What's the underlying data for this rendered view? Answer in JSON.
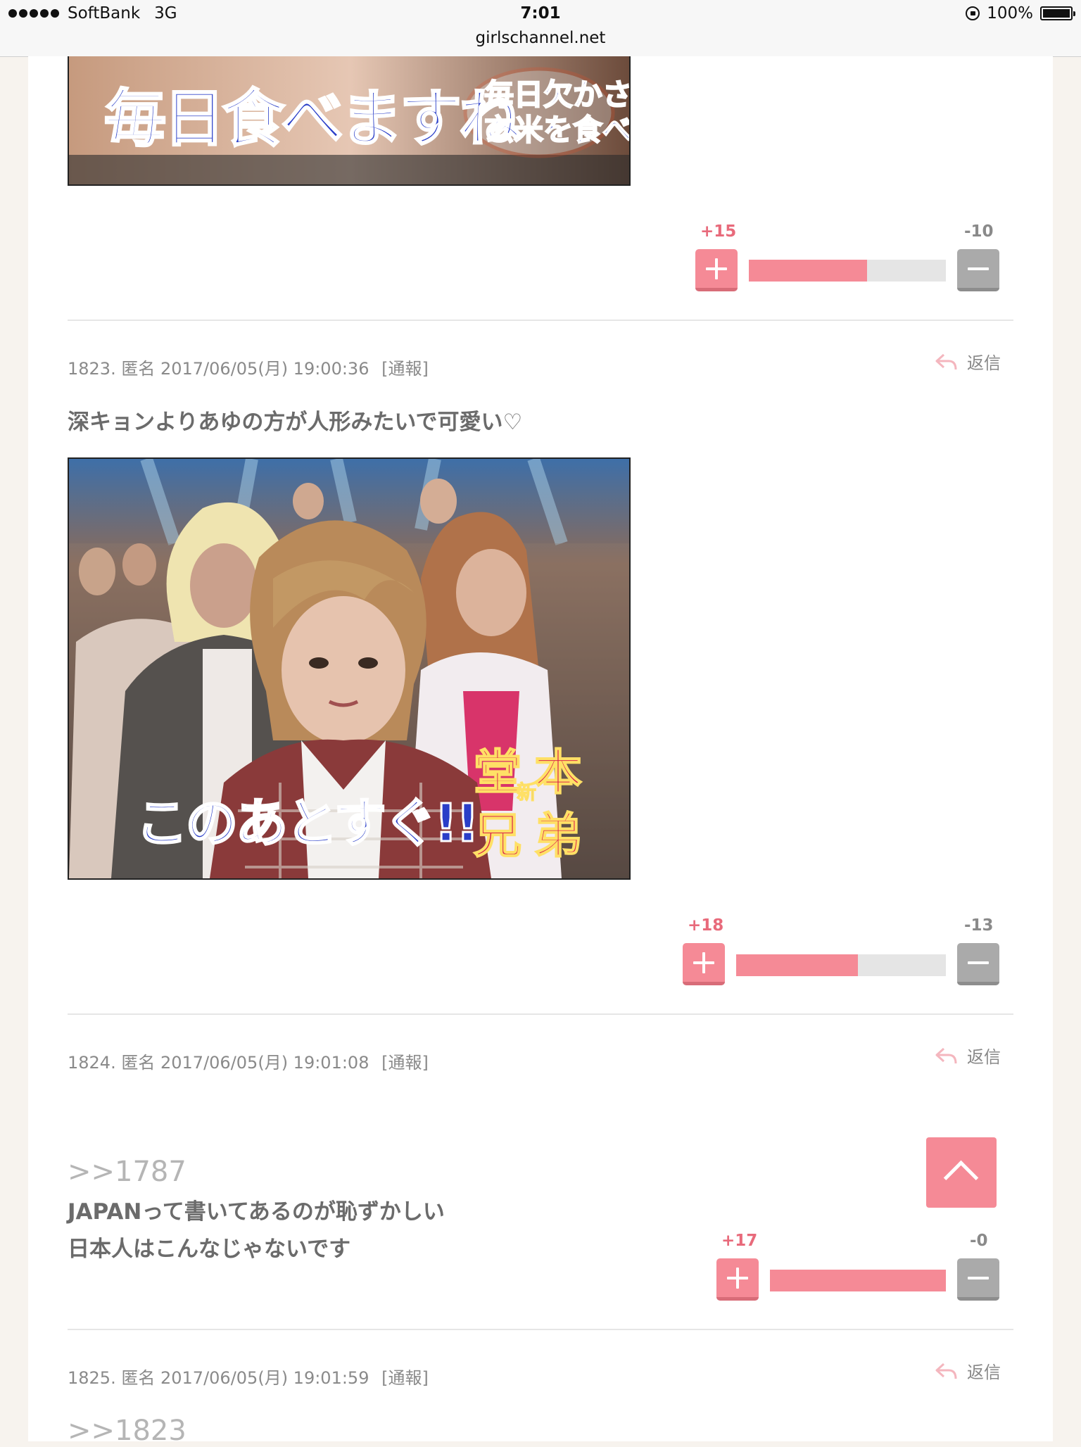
{
  "status_bar": {
    "carrier": "SoftBank",
    "network": "3G",
    "time": "7:01",
    "url": "girlschannel.net",
    "battery": "100%"
  },
  "colors": {
    "accent": "#f58a96",
    "panel": "#ffffff",
    "page_bg": "#f7f3ee"
  },
  "posts": [
    {
      "image_caption": "毎日食べますね",
      "image_subcaption_line1": "毎日欠かさず",
      "image_subcaption_line2": "玄米を食べる",
      "plus": "+15",
      "minus": "-10",
      "ratio": 0.6
    },
    {
      "number": "1823.",
      "author": "匿名",
      "datetime": "2017/06/05(月) 19:00:36",
      "report": "[通報]",
      "reply": "返信",
      "text": "深キョンよりあゆの方が人形みたいで可愛い♡",
      "image_caption": "このあとすぐ!!",
      "image_label_1": "堂本",
      "image_label_2": "兄弟",
      "image_label_small": "新",
      "plus": "+18",
      "minus": "-13",
      "ratio": 0.58
    },
    {
      "number": "1824.",
      "author": "匿名",
      "datetime": "2017/06/05(月) 19:01:08",
      "report": "[通報]",
      "reply": "返信",
      "anchor": ">>1787",
      "text_line1": "JAPANって書いてあるのが恥ずかしい",
      "text_line2": "日本人はこんなじゃないです",
      "plus": "+17",
      "minus": "-0",
      "ratio": 1.0
    },
    {
      "number": "1825.",
      "author": "匿名",
      "datetime": "2017/06/05(月) 19:01:59",
      "report": "[通報]",
      "reply": "返信",
      "anchor": ">>1823"
    }
  ]
}
